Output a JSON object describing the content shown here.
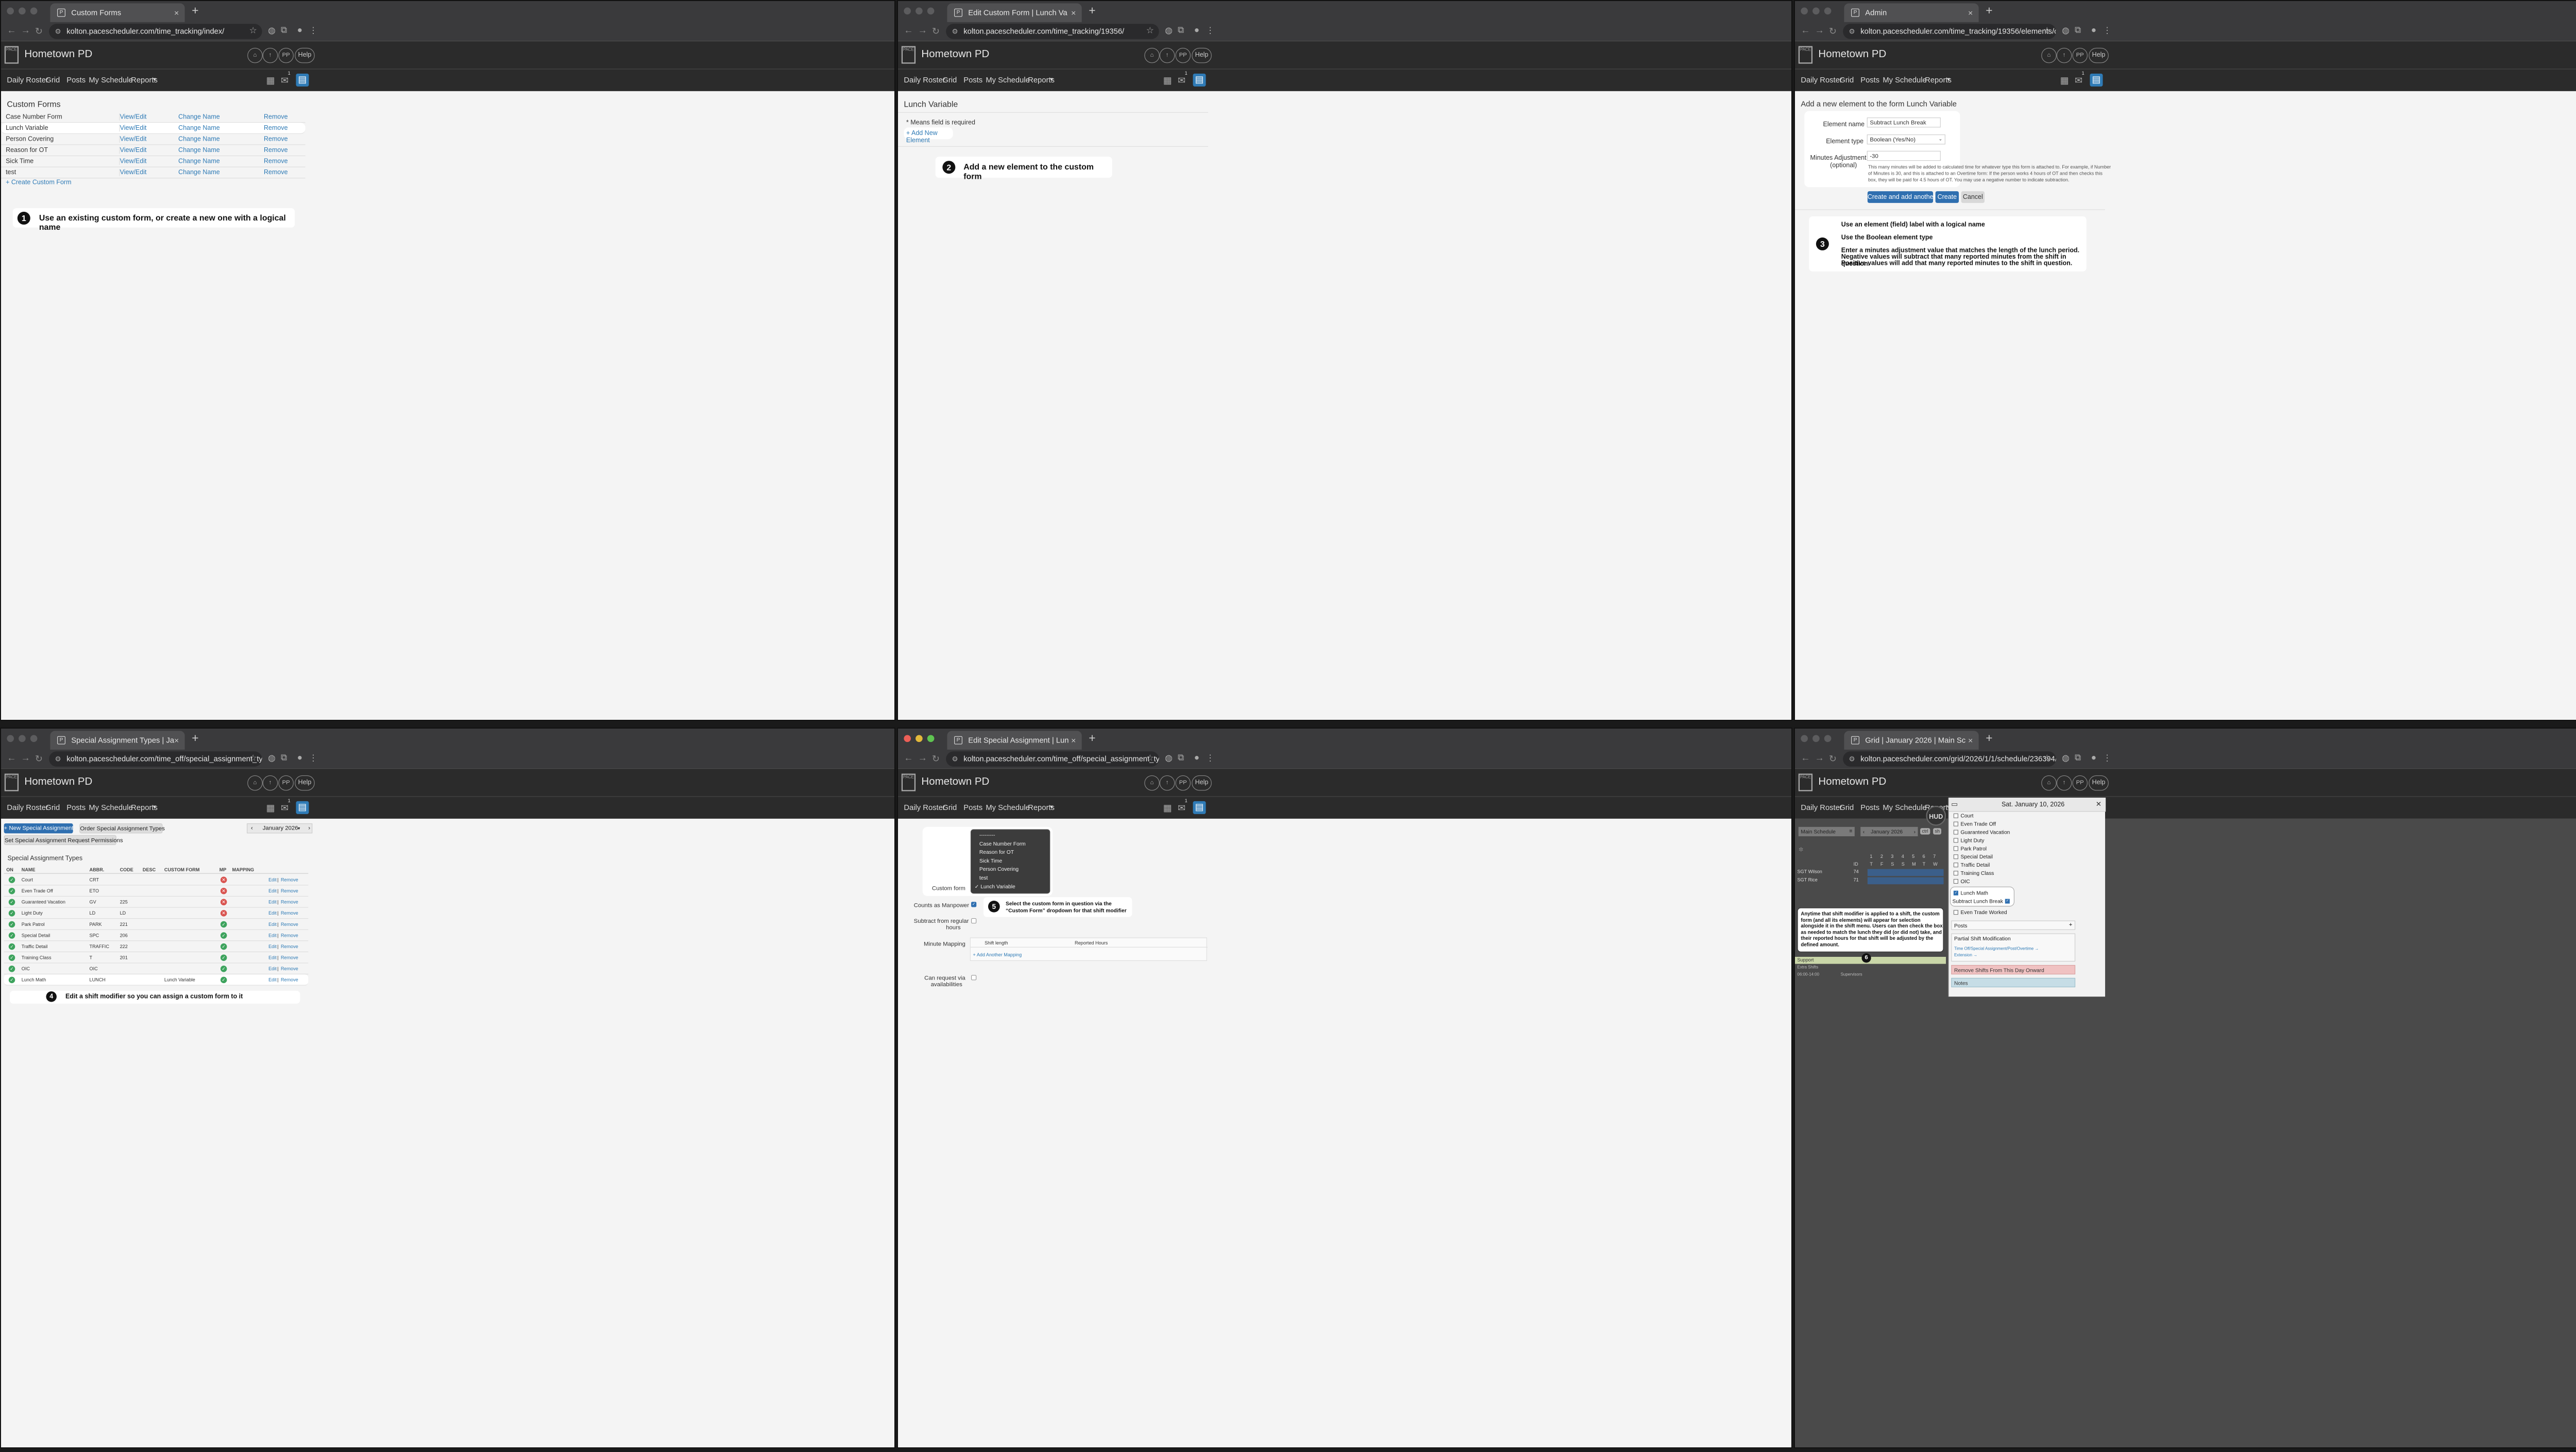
{
  "browser": {
    "panels": [
      {
        "tab": "Custom Forms",
        "url": "kolton.pacescheduler.com/time_tracking/index/"
      },
      {
        "tab": "Edit Custom Form | Lunch Va",
        "url": "kolton.pacescheduler.com/time_tracking/19356/"
      },
      {
        "tab": "Admin",
        "url": "kolton.pacescheduler.com/time_tracking/19356/elements/create/"
      },
      {
        "tab": "Special Assignment Types | Ja",
        "url": "kolton.pacescheduler.com/time_off/special_assignment_type/2026/1/1/"
      },
      {
        "tab": "Edit Special Assignment | Lun",
        "url": "kolton.pacescheduler.com/time_off/special_assignment_type/3414557/e..."
      },
      {
        "tab": "Grid | January 2026 | Main Sc",
        "url": "kolton.pacescheduler.com/grid/2026/1/1/schedule/236394/"
      }
    ]
  },
  "app": {
    "brand": "Hometown PD",
    "logo": "PACE",
    "pp": "PP",
    "help": "Help",
    "menu": [
      "Daily Roster",
      "Grid",
      "Posts",
      "My Schedule",
      "Reports"
    ],
    "badge": "1"
  },
  "p1": {
    "title": "Custom Forms",
    "rows": [
      {
        "name": "Case Number Form",
        "view": "View/Edit",
        "change": "Change Name",
        "remove": "Remove"
      },
      {
        "name": "Lunch Variable",
        "view": "View/Edit",
        "change": "Change Name",
        "remove": "Remove"
      },
      {
        "name": "Person Covering",
        "view": "View/Edit",
        "change": "Change Name",
        "remove": "Remove"
      },
      {
        "name": "Reason for OT",
        "view": "View/Edit",
        "change": "Change Name",
        "remove": "Remove"
      },
      {
        "name": "Sick Time",
        "view": "View/Edit",
        "change": "Change Name",
        "remove": "Remove"
      },
      {
        "name": "test",
        "view": "View/Edit",
        "change": "Change Name",
        "remove": "Remove"
      }
    ],
    "create": "+ Create Custom Form",
    "step": "1",
    "callout": "Use an existing custom form, or create a new one with a logical name"
  },
  "p2": {
    "title": "Lunch Variable",
    "required": "* Means field is required",
    "add": "+ Add New Element",
    "step": "2",
    "callout": "Add a new element to the custom form"
  },
  "p3": {
    "title": "Add a new element to the form Lunch Variable",
    "name_label": "Element name",
    "name_value": "Subtract Lunch Break",
    "type_label": "Element type",
    "type_value": "Boolean (Yes/No)",
    "min_label": "Minutes Adjustment",
    "min_label2": "(optional)",
    "min_value": "-30",
    "help": "This many minutes will be added to calculated time for whatever type this form is attached to. For example, if Number of Minutes is 30, and this is attached to an Overtime form: If the person works 4 hours of OT and then checks this box, they will be paid for 4.5 hours of OT. You may use a negative number to indicate subtraction.",
    "btn_create_another": "Create and add another",
    "btn_create": "Create",
    "btn_cancel": "Cancel",
    "step": "3",
    "c1": "Use an element (field) label with a logical name",
    "c2": "Use the Boolean element type",
    "c3": "Enter a minutes adjustment value that matches the length of the lunch period.",
    "c4": "Negative values will subtract that many reported minutes from the shift in question.",
    "c5": "Positive values will add that many reported minutes to the shift in question."
  },
  "p4": {
    "new_btn": "+ New Special Assignment",
    "order_btn": "Order Special Assignment Types",
    "perm_btn": "Set Special Assignment Request Permissions",
    "month": "January 2026",
    "title": "Special Assignment Types",
    "headers": [
      "ON",
      "NAME",
      "ABBR.",
      "CODE",
      "DESC",
      "CUSTOM FORM",
      "MP",
      "MAPPING"
    ],
    "rows": [
      {
        "name": "Court",
        "abbr": "CRT",
        "code": "",
        "form": "",
        "mp": "no"
      },
      {
        "name": "Even Trade Off",
        "abbr": "ETO",
        "code": "",
        "form": "",
        "mp": "no"
      },
      {
        "name": "Guaranteed Vacation",
        "abbr": "GV",
        "code": "225",
        "form": "",
        "mp": "no"
      },
      {
        "name": "Light Duty",
        "abbr": "LD",
        "code": "LD",
        "form": "",
        "mp": "no"
      },
      {
        "name": "Park Patrol",
        "abbr": "PARK",
        "code": "221",
        "form": "",
        "mp": "yes"
      },
      {
        "name": "Special Detail",
        "abbr": "SPC",
        "code": "206",
        "form": "",
        "mp": "yes"
      },
      {
        "name": "Traffic Detail",
        "abbr": "TRAFFIC",
        "code": "222",
        "form": "",
        "mp": "yes"
      },
      {
        "name": "Training Class",
        "abbr": "T",
        "code": "201",
        "form": "",
        "mp": "yes"
      },
      {
        "name": "OIC",
        "abbr": "OIC",
        "code": "",
        "form": "",
        "mp": "yes"
      },
      {
        "name": "Lunch Math",
        "abbr": "LUNCH",
        "code": "",
        "form": "Lunch Variable",
        "mp": "yes"
      }
    ],
    "edit": "Edit",
    "remove": "Remove",
    "step": "4",
    "callout": "Edit a shift modifier so you can assign a custom form to it"
  },
  "p5": {
    "dropdown": [
      "---------",
      "Case Number Form",
      "Reason for OT",
      "Sick Time",
      "Person Covering",
      "test",
      "✓ Lunch Variable"
    ],
    "custom_form_label": "Custom form",
    "manpower_label": "Counts as Manpower",
    "subtract_label1": "Subtract from regular",
    "subtract_label2": "hours",
    "mapping_label": "Minute Mapping",
    "col_shift": "Shift length",
    "col_reported": "Reported Hours",
    "add_mapping": "+ Add Another Mapping",
    "request_label1": "Can request via",
    "request_label2": "availabilities",
    "step": "5",
    "callout1": "Select the custom form in question via the",
    "callout2": "“Custom Form” dropdown for that shift modifier"
  },
  "p6": {
    "schedule": "Main Schedule",
    "month": "January 2026",
    "hud": "HUD",
    "ctrl": "ctrl",
    "sh": "sh",
    "date": "Sat. January 10, 2026",
    "list": [
      "Court",
      "Even Trade Off",
      "Guaranteed Vacation",
      "Light Duty",
      "Park Patrol",
      "Special Detail",
      "Traffic Detail",
      "Training Class",
      "OIC"
    ],
    "lunch_math": "Lunch Math",
    "subtract": "Subtract Lunch Break",
    "etw": "Even Trade Worked",
    "posts": "Posts",
    "partial": "Partial Shift Modification",
    "link1": "Time Off/Special Assignment/Post/Overtime →",
    "link2": "Extension →",
    "remove_shifts": "Remove Shifts From This Day Onward",
    "notes": "Notes",
    "rows": [
      {
        "name": "SGT Wilson",
        "id": "74"
      },
      {
        "name": "SGT Rice",
        "id": "71"
      }
    ],
    "days_top": [
      "1",
      "2",
      "3",
      "4",
      "5",
      "6",
      "7"
    ],
    "days_bot": [
      "T",
      "F",
      "S",
      "S",
      "M",
      "T",
      "W"
    ],
    "id_head": "ID",
    "ofc": "OFC Petillo",
    "ofc_id": "78",
    "support": "Support",
    "extra": "Extra Shifts",
    "supervisors": "Supervisors",
    "officers": "Officers",
    "time": "06:00-14:00",
    "step": "6",
    "callout": "Anytime that shift modifier is applied to a shift, the custom form (and all its elements) will appear for selection alongside it in the shift menu. Users can then check the box as needed to match the lunch they did (or did not) take, and their reported hours for that shift will be adjusted by the defined amount."
  },
  "colors": {
    "accent": "#2f7bb6",
    "header": "#2b2b2b",
    "chrome": "#3a3a3c",
    "ok": "#3da35d",
    "no": "#d9534f"
  }
}
